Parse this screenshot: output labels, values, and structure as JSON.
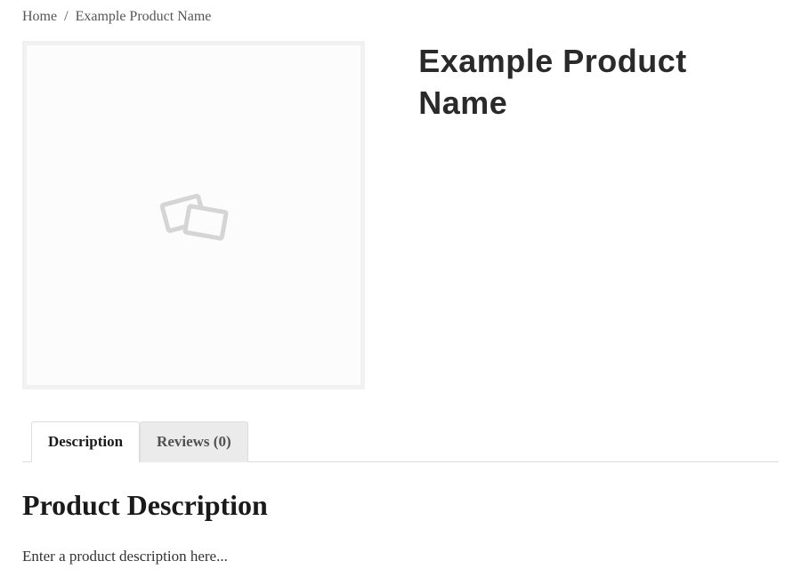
{
  "breadcrumb": {
    "home_label": "Home",
    "separator": "/",
    "current": "Example Product Name"
  },
  "product": {
    "title": "Example Product Name"
  },
  "tabs": {
    "description_label": "Description",
    "reviews_label": "Reviews (0)"
  },
  "description": {
    "heading": "Product Description",
    "text": "Enter a product description here..."
  }
}
